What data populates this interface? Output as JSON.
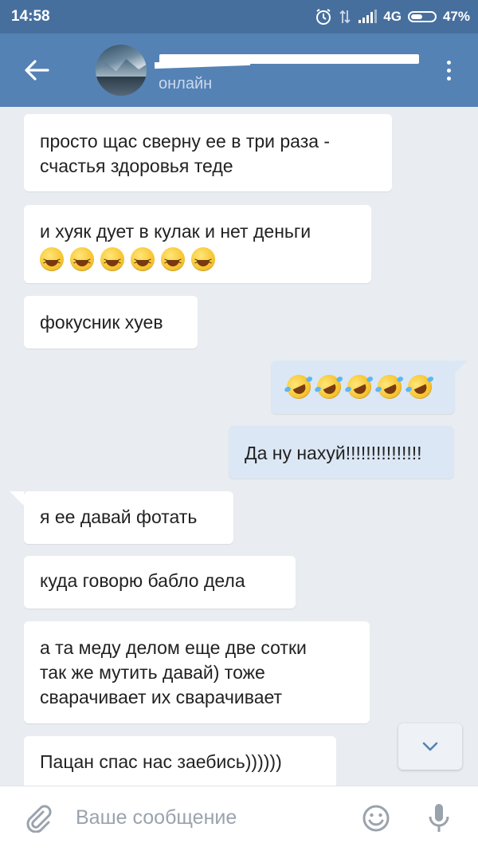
{
  "status_bar": {
    "time": "14:58",
    "network": "4G",
    "battery": "47%"
  },
  "header": {
    "contact_status": "онлайн"
  },
  "messages": [
    {
      "direction": "in",
      "text_line1": "просто щас сверну ее в три раза -",
      "text_line2": "счастья здоровья теде"
    },
    {
      "direction": "in",
      "text": "и хуяк дует в кулак и нет деньги",
      "emojis": [
        "grinning-squinting-face",
        "grinning-squinting-face",
        "grinning-squinting-face",
        "grinning-squinting-face",
        "grinning-squinting-face",
        "grinning-squinting-face"
      ]
    },
    {
      "direction": "in",
      "text": "фокусник хуев"
    },
    {
      "direction": "out",
      "emojis": [
        "rolling-on-floor-laughing",
        "rolling-on-floor-laughing",
        "rolling-on-floor-laughing",
        "rolling-on-floor-laughing",
        "rolling-on-floor-laughing"
      ]
    },
    {
      "direction": "out",
      "text": "Да ну нахуй!!!!!!!!!!!!!!!"
    },
    {
      "direction": "in",
      "text": "я ее давай фотать"
    },
    {
      "direction": "in",
      "text": "куда говорю бабло дела"
    },
    {
      "direction": "in",
      "text_line1": "а та меду делом еще две сотки",
      "text_line2": "так же мутить давай) тоже",
      "text_line3": "сварачивает их сварачивает"
    },
    {
      "direction": "in",
      "text": "Пацан спас нас заебись))))))"
    }
  ],
  "composer": {
    "placeholder": "Ваше сообщение"
  },
  "colors": {
    "status_bar": "#466f9e",
    "header": "#5582b5",
    "background": "#e9edf2",
    "incoming_bubble": "#ffffff",
    "outgoing_bubble": "#dbe7f4"
  }
}
